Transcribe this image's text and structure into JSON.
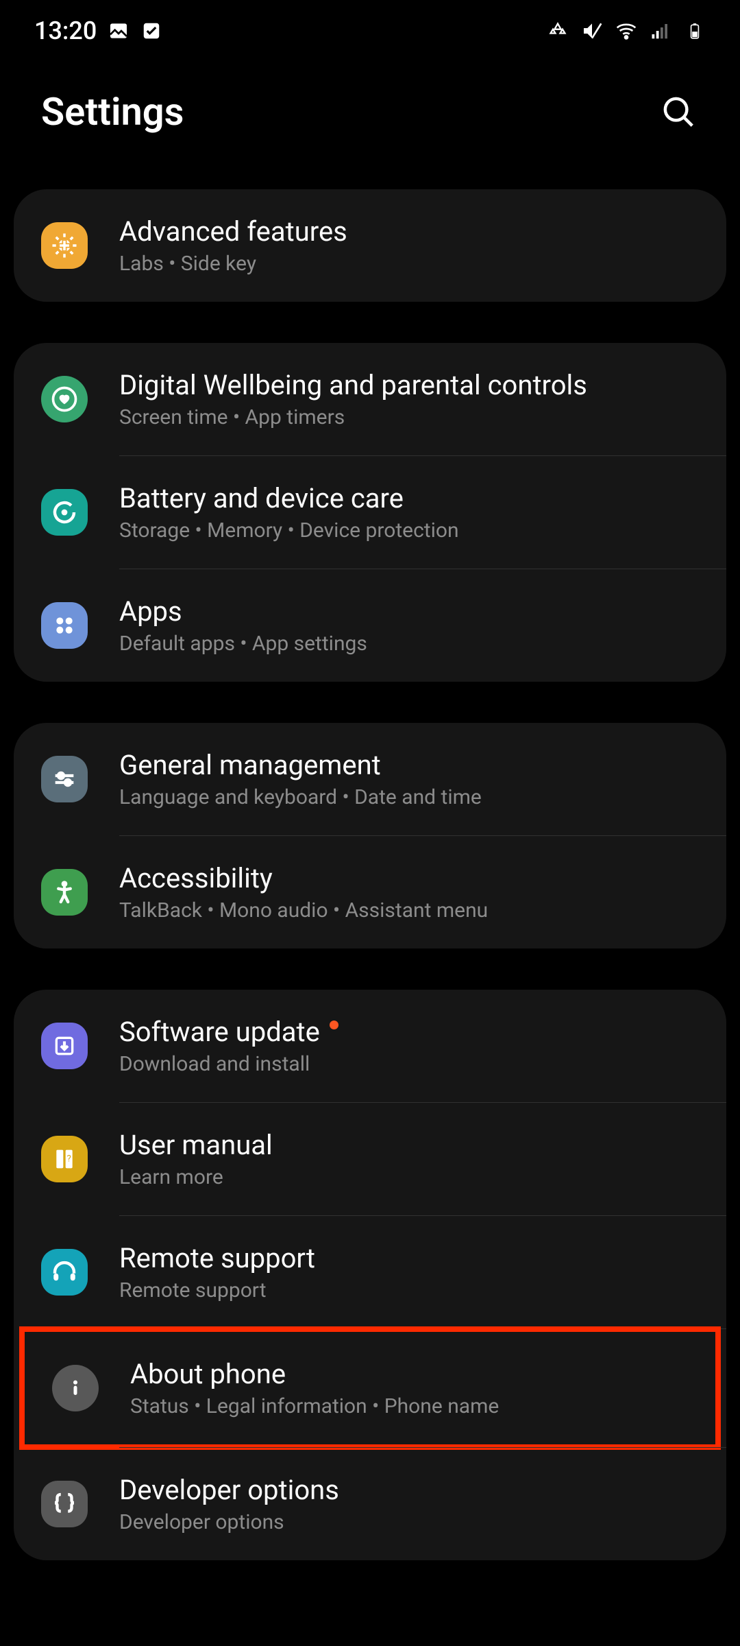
{
  "status": {
    "time": "13:20",
    "icons": [
      "picture-icon",
      "checkbox-icon",
      "recycle-icon",
      "mute-icon",
      "wifi-icon",
      "signal-icon",
      "battery-icon"
    ]
  },
  "header": {
    "title": "Settings"
  },
  "groups": [
    {
      "items": [
        {
          "id": "advanced-features",
          "title": "Advanced features",
          "sub": "Labs  •  Side key",
          "iconBg": "icon-bg-orange",
          "icon": "gear-plus-icon"
        }
      ]
    },
    {
      "items": [
        {
          "id": "digital-wellbeing",
          "title": "Digital Wellbeing and parental controls",
          "sub": "Screen time  •  App timers",
          "iconBg": "icon-bg-greencircle",
          "icon": "heart-circle-icon"
        },
        {
          "id": "battery-device-care",
          "title": "Battery and device care",
          "sub": "Storage  •  Memory  •  Device protection",
          "iconBg": "icon-bg-teal",
          "icon": "refresh-icon"
        },
        {
          "id": "apps",
          "title": "Apps",
          "sub": "Default apps  •  App settings",
          "iconBg": "icon-bg-blue",
          "icon": "grid-4-icon"
        }
      ]
    },
    {
      "items": [
        {
          "id": "general-management",
          "title": "General management",
          "sub": "Language and keyboard  •  Date and time",
          "iconBg": "icon-bg-slate",
          "icon": "sliders-icon"
        },
        {
          "id": "accessibility",
          "title": "Accessibility",
          "sub": "TalkBack  •  Mono audio  •  Assistant menu",
          "iconBg": "icon-bg-green",
          "icon": "person-icon"
        }
      ]
    },
    {
      "items": [
        {
          "id": "software-update",
          "title": "Software update",
          "sub": "Download and install",
          "iconBg": "icon-bg-purple",
          "icon": "download-box-icon",
          "badge": true
        },
        {
          "id": "user-manual",
          "title": "User manual",
          "sub": "Learn more",
          "iconBg": "icon-bg-olive",
          "icon": "book-icon"
        },
        {
          "id": "remote-support",
          "title": "Remote support",
          "sub": "Remote support",
          "iconBg": "icon-bg-cyan",
          "icon": "headset-icon"
        },
        {
          "id": "about-phone",
          "title": "About phone",
          "sub": "Status  •  Legal information  •  Phone name",
          "iconBg": "icon-bg-gray",
          "icon": "info-icon",
          "highlighted": true
        },
        {
          "id": "developer-options",
          "title": "Developer options",
          "sub": "Developer options",
          "iconBg": "icon-bg-darkgray",
          "icon": "braces-icon"
        }
      ]
    }
  ]
}
